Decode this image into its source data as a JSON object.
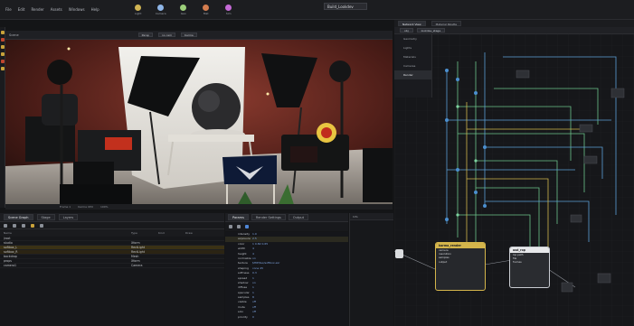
{
  "menubar": {
    "items": [
      "File",
      "Edit",
      "Render",
      "Assets",
      "Windows",
      "Help"
    ],
    "tools": [
      "Light",
      "Camera",
      "Geo",
      "Mat",
      "Sim"
    ],
    "desktop": "Build_Lookdev"
  },
  "viewport": {
    "title": "Scene",
    "persp": "Persp",
    "camera": "no cam",
    "display": "Karma",
    "footer": [
      "Frame 1",
      "Karma XPU",
      "100%"
    ],
    "colors": {
      "bg": "#3b1a15",
      "backdrop": "#e9e9e6",
      "lamp": "#c9a23a"
    }
  },
  "lower_left": {
    "tabs": [
      "Scene Graph",
      "Stage",
      "Layers"
    ],
    "columns": [
      "Name",
      "Type",
      "Kind",
      "Draw"
    ],
    "rows": [
      {
        "name": "/root",
        "type": "",
        "kind": "",
        "sel": "none"
      },
      {
        "name": "  studio",
        "type": "Xform",
        "kind": "",
        "sel": "none"
      },
      {
        "name": "  softbox_L",
        "type": "RectLight",
        "kind": "",
        "sel": "sel"
      },
      {
        "name": "  softbox_R",
        "type": "RectLight",
        "kind": "",
        "sel": "sel2"
      },
      {
        "name": "  backdrop",
        "type": "Mesh",
        "kind": "",
        "sel": "none"
      },
      {
        "name": "  props",
        "type": "Xform",
        "kind": "",
        "sel": "none"
      },
      {
        "name": "  camera1",
        "type": "Camera",
        "kind": "",
        "sel": "none"
      }
    ]
  },
  "lower_mid": {
    "tabs": [
      "Params",
      "Render Settings",
      "Output"
    ],
    "lines": [
      {
        "k": "intensity",
        "v": "1.0",
        "hl": false
      },
      {
        "k": "exposure",
        "v": "2.5",
        "hl": true
      },
      {
        "k": "color",
        "v": "1 0.82 0.65",
        "hl": false
      },
      {
        "k": "width",
        "v": "4",
        "hl": false
      },
      {
        "k": "height",
        "v": "4",
        "hl": false
      },
      {
        "k": "normalize",
        "v": "on",
        "hl": false
      },
      {
        "k": "texture",
        "v": "$HIP/tex/softbox.exr",
        "hl": false
      },
      {
        "k": "shaping",
        "v": "cone 45",
        "hl": false
      },
      {
        "k": "softness",
        "v": "0.3",
        "hl": false
      },
      {
        "k": "spread",
        "v": "1",
        "hl": false
      },
      {
        "k": "shadow",
        "v": "on",
        "hl": false
      },
      {
        "k": "diffuse",
        "v": "1",
        "hl": false
      },
      {
        "k": "specular",
        "v": "1",
        "hl": false
      },
      {
        "k": "samples",
        "v": "8",
        "hl": false
      },
      {
        "k": "visible",
        "v": "off",
        "hl": false
      },
      {
        "k": "mute",
        "v": "off",
        "hl": false
      },
      {
        "k": "solo",
        "v": "off",
        "hl": false
      },
      {
        "k": "priority",
        "v": "0",
        "hl": false
      }
    ]
  },
  "right_small": {
    "title": "Info"
  },
  "node_editor": {
    "tabs": [
      "Network View",
      "Material Palette"
    ],
    "path": [
      "obj",
      "lookdev_stage"
    ],
    "side_items": [
      "Geometry",
      "Lights",
      "Materials",
      "Cameras",
      "Render"
    ],
    "node_a": {
      "title": "karma_render",
      "lines": [
        "camera",
        "resolution",
        "samples",
        "output"
      ]
    },
    "node_b": {
      "title": "usd_rop",
      "lines": [
        "lop path",
        "file",
        "frames"
      ]
    }
  }
}
